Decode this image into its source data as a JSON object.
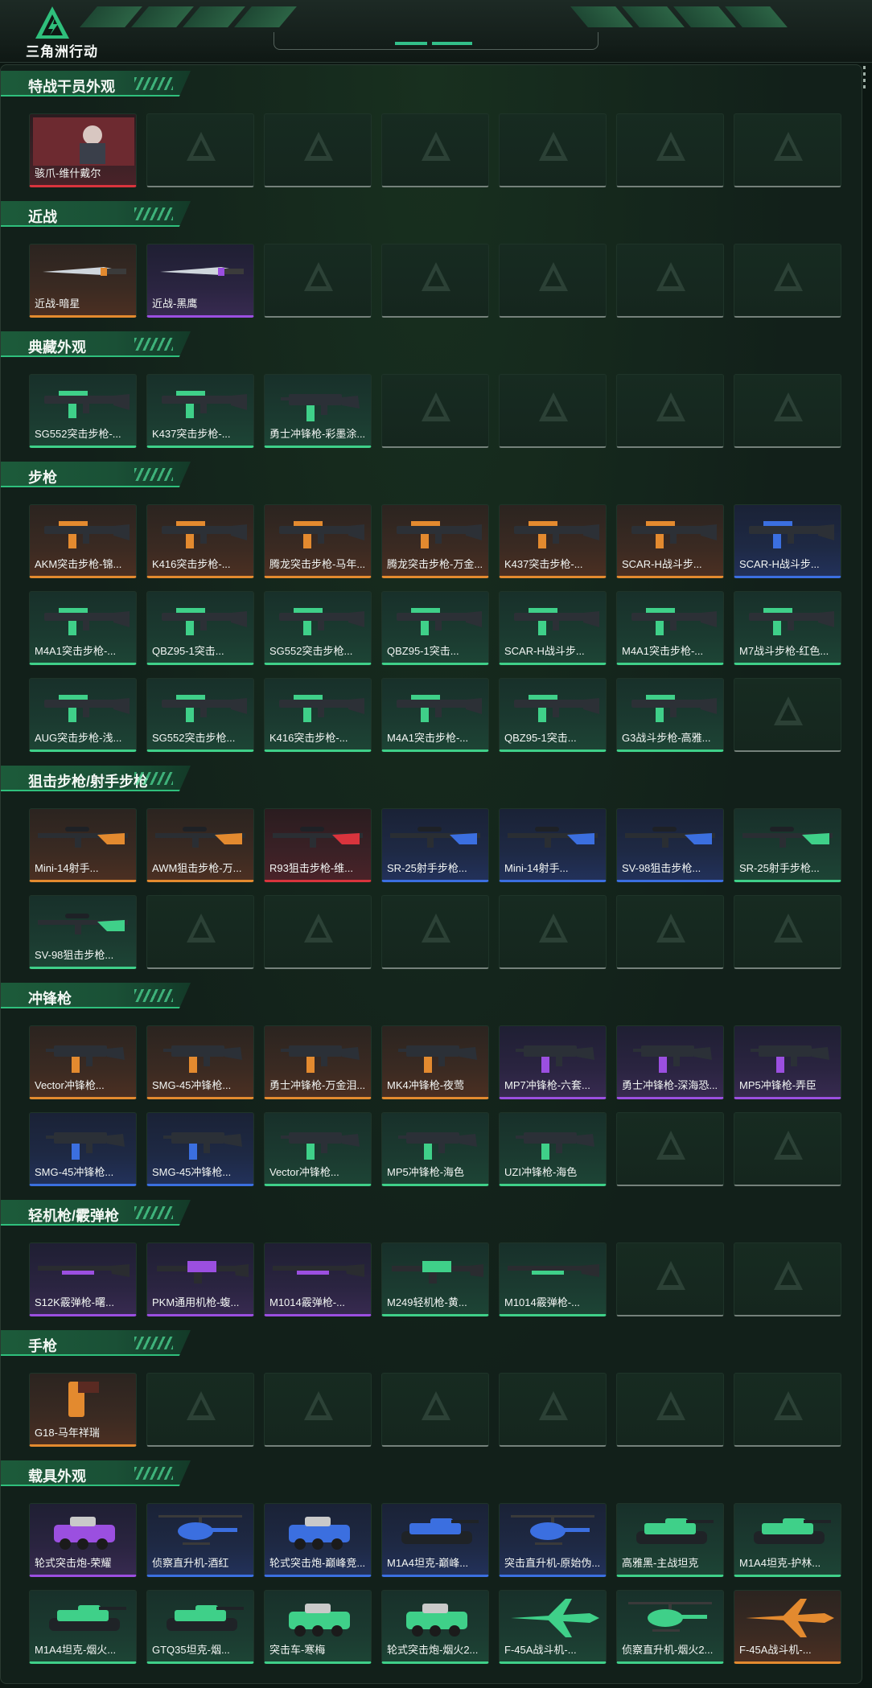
{
  "header": {
    "game_title": "三角洲行动"
  },
  "colors": {
    "accent": "#3fd089",
    "orange": "#e38a2f",
    "red": "#d9343d",
    "purple": "#9b4fe0",
    "blue": "#3b6fe0",
    "green": "#3fd089",
    "gray": "#8a948e"
  },
  "sections": [
    {
      "title": "特战干员外观",
      "rows": [
        [
          {
            "label": "骇爪-维什戴尔",
            "rarity": "red",
            "icon": "operator-portrait"
          }
        ]
      ]
    },
    {
      "title": "近战",
      "rows": [
        [
          {
            "label": "近战-暗星",
            "rarity": "orange",
            "icon": "knife"
          },
          {
            "label": "近战-黑鹰",
            "rarity": "purple",
            "icon": "knife"
          }
        ]
      ]
    },
    {
      "title": "典藏外观",
      "rows": [
        [
          {
            "label": "SG552突击步枪-...",
            "rarity": "green",
            "icon": "rifle"
          },
          {
            "label": "K437突击步枪-...",
            "rarity": "green",
            "icon": "rifle"
          },
          {
            "label": "勇士冲锋枪-彩墨涂...",
            "rarity": "green",
            "icon": "smg"
          }
        ]
      ]
    },
    {
      "title": "步枪",
      "rows": [
        [
          {
            "label": "AKM突击步枪-锦...",
            "rarity": "orange",
            "icon": "rifle"
          },
          {
            "label": "K416突击步枪-...",
            "rarity": "orange",
            "icon": "rifle"
          },
          {
            "label": "腾龙突击步枪-马年...",
            "rarity": "orange",
            "icon": "rifle"
          },
          {
            "label": "腾龙突击步枪-万金...",
            "rarity": "orange",
            "icon": "rifle"
          },
          {
            "label": "K437突击步枪-...",
            "rarity": "orange",
            "icon": "rifle"
          },
          {
            "label": "SCAR-H战斗步...",
            "rarity": "orange",
            "icon": "rifle"
          },
          {
            "label": "SCAR-H战斗步...",
            "rarity": "blue",
            "icon": "rifle"
          }
        ],
        [
          {
            "label": "M4A1突击步枪-...",
            "rarity": "green",
            "icon": "rifle"
          },
          {
            "label": "QBZ95-1突击...",
            "rarity": "green",
            "icon": "rifle"
          },
          {
            "label": "SG552突击步枪...",
            "rarity": "green",
            "icon": "rifle"
          },
          {
            "label": "QBZ95-1突击...",
            "rarity": "green",
            "icon": "rifle"
          },
          {
            "label": "SCAR-H战斗步...",
            "rarity": "green",
            "icon": "rifle"
          },
          {
            "label": "M4A1突击步枪-...",
            "rarity": "green",
            "icon": "rifle"
          },
          {
            "label": "M7战斗步枪-红色...",
            "rarity": "green",
            "icon": "rifle"
          }
        ],
        [
          {
            "label": "AUG突击步枪-浅...",
            "rarity": "green",
            "icon": "rifle"
          },
          {
            "label": "SG552突击步枪...",
            "rarity": "green",
            "icon": "rifle"
          },
          {
            "label": "K416突击步枪-...",
            "rarity": "green",
            "icon": "rifle"
          },
          {
            "label": "M4A1突击步枪-...",
            "rarity": "green",
            "icon": "rifle"
          },
          {
            "label": "QBZ95-1突击...",
            "rarity": "green",
            "icon": "rifle"
          },
          {
            "label": "G3战斗步枪-高雅...",
            "rarity": "green",
            "icon": "rifle"
          }
        ]
      ]
    },
    {
      "title": "狙击步枪/射手步枪",
      "rows": [
        [
          {
            "label": "Mini-14射手...",
            "rarity": "orange",
            "icon": "sniper"
          },
          {
            "label": "AWM狙击步枪-万...",
            "rarity": "orange",
            "icon": "sniper"
          },
          {
            "label": "R93狙击步枪-维...",
            "rarity": "red",
            "icon": "sniper"
          },
          {
            "label": "SR-25射手步枪...",
            "rarity": "blue",
            "icon": "sniper"
          },
          {
            "label": "Mini-14射手...",
            "rarity": "blue",
            "icon": "sniper"
          },
          {
            "label": "SV-98狙击步枪...",
            "rarity": "blue",
            "icon": "sniper"
          },
          {
            "label": "SR-25射手步枪...",
            "rarity": "green",
            "icon": "sniper"
          }
        ],
        [
          {
            "label": "SV-98狙击步枪...",
            "rarity": "green",
            "icon": "sniper"
          }
        ]
      ]
    },
    {
      "title": "冲锋枪",
      "rows": [
        [
          {
            "label": "Vector冲锋枪...",
            "rarity": "orange",
            "icon": "smg"
          },
          {
            "label": "SMG-45冲锋枪...",
            "rarity": "orange",
            "icon": "smg"
          },
          {
            "label": "勇士冲锋枪-万金泪...",
            "rarity": "orange",
            "icon": "smg"
          },
          {
            "label": "MK4冲锋枪-夜莺",
            "rarity": "orange",
            "icon": "smg"
          },
          {
            "label": "MP7冲锋枪-六套...",
            "rarity": "purple",
            "icon": "smg"
          },
          {
            "label": "勇士冲锋枪-深海恐...",
            "rarity": "purple",
            "icon": "smg"
          },
          {
            "label": "MP5冲锋枪-弄臣",
            "rarity": "purple",
            "icon": "smg"
          }
        ],
        [
          {
            "label": "SMG-45冲锋枪...",
            "rarity": "blue",
            "icon": "smg"
          },
          {
            "label": "SMG-45冲锋枪...",
            "rarity": "blue",
            "icon": "smg"
          },
          {
            "label": "Vector冲锋枪...",
            "rarity": "green",
            "icon": "smg"
          },
          {
            "label": "MP5冲锋枪-海色",
            "rarity": "green",
            "icon": "smg"
          },
          {
            "label": "UZI冲锋枪-海色",
            "rarity": "green",
            "icon": "smg"
          }
        ]
      ]
    },
    {
      "title": "轻机枪/霰弹枪",
      "rows": [
        [
          {
            "label": "S12K霰弹枪-曙...",
            "rarity": "purple",
            "icon": "shotgun"
          },
          {
            "label": "PKM通用机枪-蝮...",
            "rarity": "purple",
            "icon": "lmg"
          },
          {
            "label": "M1014霰弹枪-...",
            "rarity": "purple",
            "icon": "shotgun"
          },
          {
            "label": "M249轻机枪-黄...",
            "rarity": "green",
            "icon": "lmg"
          },
          {
            "label": "M1014霰弹枪-...",
            "rarity": "green",
            "icon": "shotgun"
          }
        ]
      ]
    },
    {
      "title": "手枪",
      "rows": [
        [
          {
            "label": "G18-马年祥瑞",
            "rarity": "orange",
            "icon": "pistol"
          }
        ]
      ]
    },
    {
      "title": "载具外观",
      "rows": [
        [
          {
            "label": "轮式突击炮-荣耀",
            "rarity": "purple",
            "icon": "vehicle"
          },
          {
            "label": "侦察直升机-酒红",
            "rarity": "blue",
            "icon": "helicopter"
          },
          {
            "label": "轮式突击炮-巅峰竞...",
            "rarity": "blue",
            "icon": "vehicle"
          },
          {
            "label": "M1A4坦克-巅峰...",
            "rarity": "blue",
            "icon": "tank"
          },
          {
            "label": "突击直升机-原始伪...",
            "rarity": "blue",
            "icon": "helicopter"
          },
          {
            "label": "高雅黑-主战坦克",
            "rarity": "green",
            "icon": "tank"
          },
          {
            "label": "M1A4坦克-护林...",
            "rarity": "green",
            "icon": "tank"
          }
        ],
        [
          {
            "label": "M1A4坦克-烟火...",
            "rarity": "green",
            "icon": "tank"
          },
          {
            "label": "GTQ35坦克-烟...",
            "rarity": "green",
            "icon": "tank"
          },
          {
            "label": "突击车-寒梅",
            "rarity": "green",
            "icon": "vehicle"
          },
          {
            "label": "轮式突击炮-烟火2...",
            "rarity": "green",
            "icon": "vehicle"
          },
          {
            "label": "F-45A战斗机-...",
            "rarity": "green",
            "icon": "jet"
          },
          {
            "label": "侦察直升机-烟火2...",
            "rarity": "green",
            "icon": "helicopter"
          },
          {
            "label": "F-45A战斗机-...",
            "rarity": "orange",
            "icon": "jet"
          }
        ]
      ]
    }
  ]
}
